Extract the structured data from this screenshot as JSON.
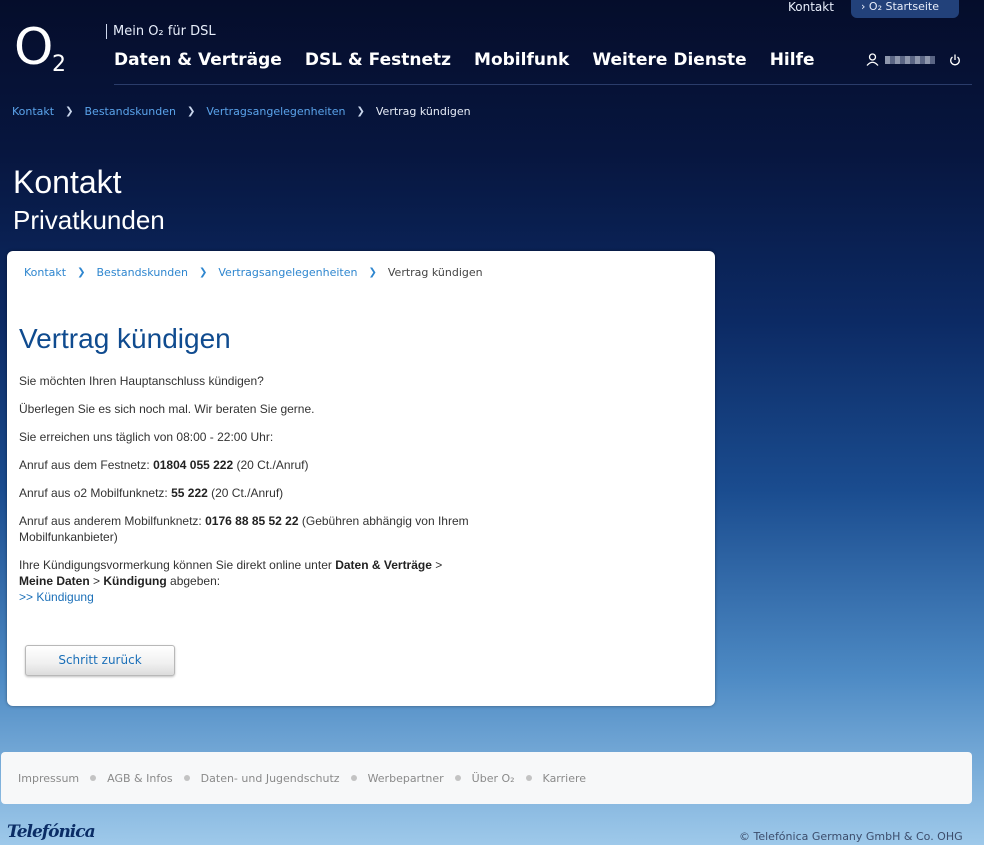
{
  "brand": {
    "logo_letter": "O",
    "logo_sub": "2",
    "mein_label": "Mein O₂ für DSL"
  },
  "topnav": {
    "items": [
      "Daten & Verträge",
      "DSL & Festnetz",
      "Mobilfunk",
      "Weitere Dienste",
      "Hilfe"
    ]
  },
  "toplinks": {
    "kontakt": "Kontakt",
    "startseite": "O₂ Startseite"
  },
  "breadcrumb": {
    "items": [
      "Kontakt",
      "Bestandskunden",
      "Vertragsangelegenheiten"
    ],
    "current": "Vertrag kündigen"
  },
  "page": {
    "title": "Kontakt",
    "subtitle": "Privatkunden"
  },
  "card": {
    "title": "Vertrag kündigen",
    "p1": "Sie möchten Ihren Hauptanschluss kündigen?",
    "p2": "Überlegen Sie es sich noch mal. Wir beraten Sie gerne.",
    "p3": "Sie erreichen uns täglich von 08:00 - 22:00 Uhr:",
    "festnetz_label": "Anruf aus dem Festnetz: ",
    "festnetz_number": "01804 055 222",
    "festnetz_price": " (20 Ct./Anruf)",
    "o2_label": "Anruf aus o2 Mobilfunknetz: ",
    "o2_number": "55 222",
    "o2_price": " (20 Ct./Anruf)",
    "other_label": "Anruf aus anderem Mobilfunknetz: ",
    "other_number": "0176 88 85 52 22",
    "other_note": " (Gebühren abhängig von Ihrem Mobilfunkanbieter)",
    "online_text": "Ihre Kündigungsvormerkung können Sie direkt online unter ",
    "online_path1": "Daten & Verträge",
    "online_sep": " > ",
    "online_path2": "Meine Daten",
    "online_sep2": " > ",
    "online_path3": "Kündigung",
    "online_end": " abgeben:",
    "link_kuendigung": ">> Kündigung",
    "back_button": "Schritt zurück"
  },
  "footer": {
    "items": [
      "Impressum",
      "AGB & Infos",
      "Daten- und Jugendschutz",
      "Werbepartner",
      "Über O₂",
      "Karriere"
    ]
  },
  "telefonica": "Telefónica",
  "copyright": "© Telefónica Germany GmbH & Co. OHG"
}
